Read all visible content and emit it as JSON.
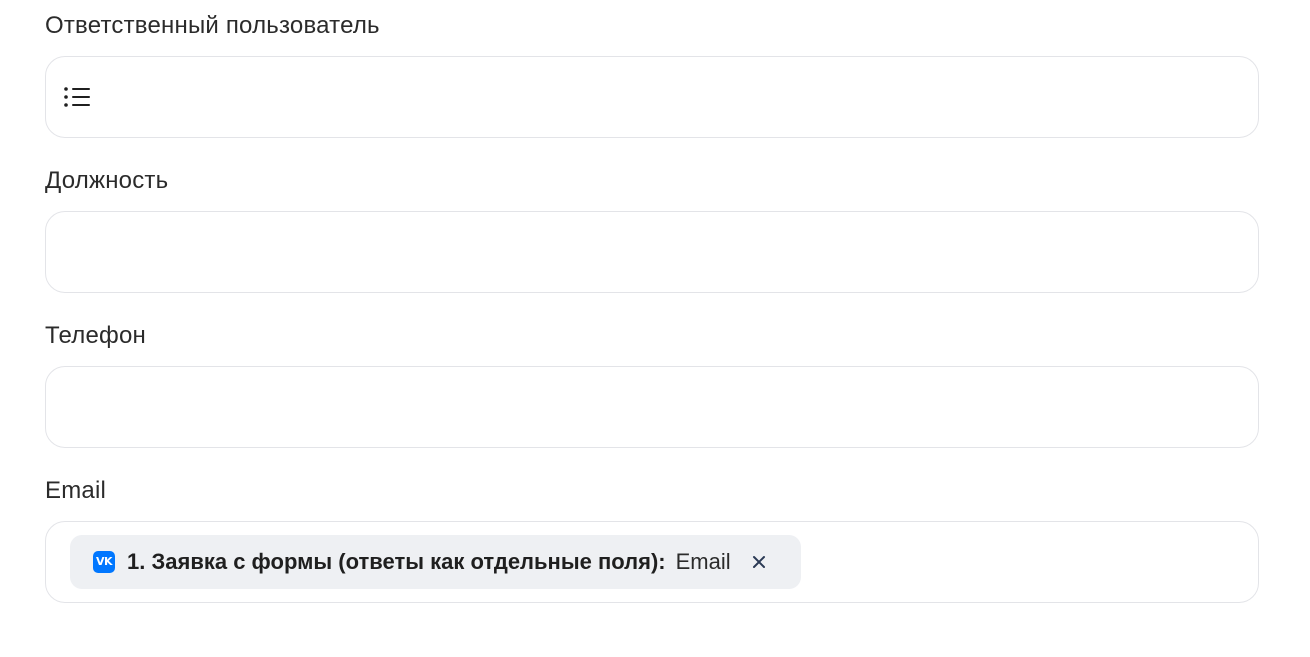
{
  "fields": [
    {
      "label": "Ответственный пользователь",
      "value": "",
      "icon": "list-icon"
    },
    {
      "label": "Должность",
      "value": ""
    },
    {
      "label": "Телефон",
      "value": ""
    },
    {
      "label": "Email",
      "value": ""
    }
  ],
  "email_tag": {
    "source_icon": "vk-icon",
    "source_icon_text": "VK",
    "source_label": "1. Заявка с формы (ответы как отдельные поля):",
    "field_label": "Email",
    "remove_icon": "close-icon"
  },
  "colors": {
    "border": "#e3e4e8",
    "chip_bg": "#eef0f3",
    "vk_blue": "#0077ff",
    "text": "#2b2b2b"
  }
}
